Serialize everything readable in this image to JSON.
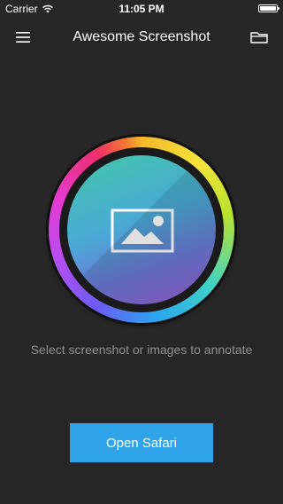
{
  "status_bar": {
    "carrier": "Carrier",
    "time": "11:05 PM",
    "wifi_icon": "wifi-icon",
    "battery_icon": "battery-icon"
  },
  "nav": {
    "title": "Awesome Screenshot",
    "left_icon": "hamburger-menu-icon",
    "right_icon": "folder-icon"
  },
  "main": {
    "hero_icon": "image-icon",
    "hint": "Select screenshot or images to annotate",
    "open_button_label": "Open Safari"
  },
  "colors": {
    "background": "#262626",
    "button": "#2fa3e8",
    "hint_text": "#8f8f8f"
  }
}
